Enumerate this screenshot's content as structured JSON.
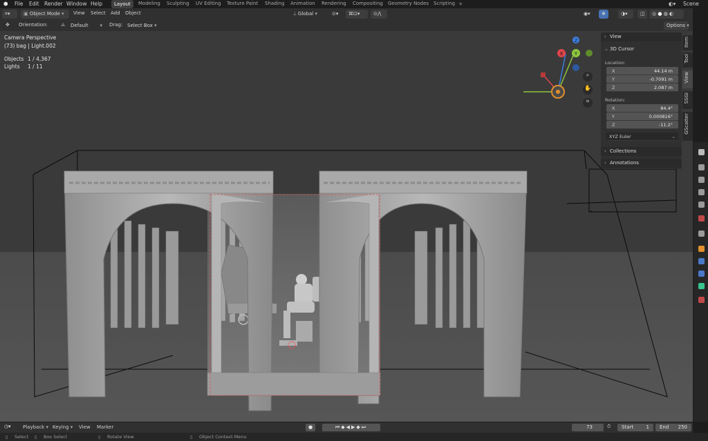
{
  "menu": [
    "File",
    "Edit",
    "Render",
    "Window",
    "Help"
  ],
  "workspaces": [
    "Layout",
    "Modeling",
    "Sculpting",
    "UV Editing",
    "Texture Paint",
    "Shading",
    "Animation",
    "Rendering",
    "Compositing",
    "Geometry Nodes",
    "Scripting"
  ],
  "active_workspace": "Layout",
  "scene_name": "Scene",
  "header": {
    "mode": "Object Mode",
    "menus": [
      "View",
      "Select",
      "Add",
      "Object"
    ],
    "transform_orientation": "Global",
    "orientation_label": "Orientation:",
    "orientation_value": "Default",
    "drag_label": "Drag:",
    "drag_value": "Select Box",
    "options": "Options"
  },
  "viewport": {
    "camera_label": "Camera Perspective",
    "object_label": "(73) bag | Light.002",
    "objects_label": "Objects",
    "objects_value": "1 / 4,367",
    "lights_label": "Lights",
    "lights_value": "1 / 11",
    "gizmo_x": "X",
    "gizmo_y": "Y",
    "gizmo_z": "Z"
  },
  "npanel": {
    "view_header": "View",
    "cursor_header": "3D Cursor",
    "location_label": "Location:",
    "location": [
      {
        "axis": "X",
        "value": "44.14 m"
      },
      {
        "axis": "Y",
        "value": "-0.7091 m"
      },
      {
        "axis": "Z",
        "value": "2.087 m"
      }
    ],
    "rotation_label": "Rotation:",
    "rotation": [
      {
        "axis": "X",
        "value": "84.4°"
      },
      {
        "axis": "Y",
        "value": "0.000816°"
      },
      {
        "axis": "Z",
        "value": "-11.2°"
      }
    ],
    "rotation_mode": "XYZ Euler",
    "collections": "Collections",
    "annotations": "Annotations"
  },
  "sidebar_tabs": [
    "Item",
    "Tool",
    "View",
    "SSGI",
    "GScatter"
  ],
  "active_sidebar_tab": "View",
  "timeline": {
    "playback": "Playback",
    "keying": "Keying",
    "view": "View",
    "marker": "Marker",
    "current_frame": "73",
    "start_label": "Start",
    "start_value": "1",
    "end_label": "End",
    "end_value": "250"
  },
  "status": {
    "select": "Select",
    "box_select": "Box Select",
    "rotate_view": "Rotate View",
    "context_menu": "Object Context Menu"
  },
  "colors": {
    "x_axis": "#e0444b",
    "y_axis": "#8cc63e",
    "z_axis": "#3d7ee0",
    "selected": "#e08f2c",
    "accent": "#4772b3"
  }
}
